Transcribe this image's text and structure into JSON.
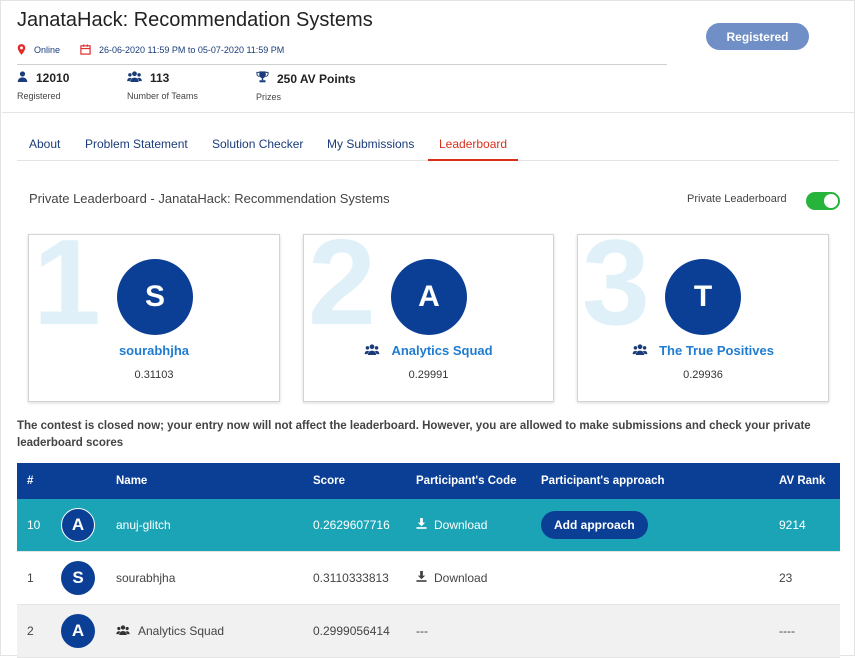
{
  "header": {
    "title": "JanataHack: Recommendation Systems",
    "mode": "Online",
    "dates": "26-06-2020 11:59 PM to 05-07-2020 11:59 PM",
    "register_button": "Registered",
    "stats": [
      {
        "value": "12010",
        "label": "Registered",
        "icon": "user-icon"
      },
      {
        "value": "113",
        "label": "Number of Teams",
        "icon": "team-icon"
      },
      {
        "value": "250 AV Points",
        "label": "Prizes",
        "icon": "trophy-icon"
      }
    ]
  },
  "tabs": [
    "About",
    "Problem Statement",
    "Solution Checker",
    "My Submissions",
    "Leaderboard"
  ],
  "active_tab": "Leaderboard",
  "leaderboard": {
    "title": "Private Leaderboard - JanataHack: Recommendation Systems",
    "toggle_label": "Private Leaderboard",
    "toggle_on": true
  },
  "podium": [
    {
      "rank": "1",
      "initial": "S",
      "name": "sourabhjha",
      "score": "0.31103",
      "team": false
    },
    {
      "rank": "2",
      "initial": "A",
      "name": "Analytics Squad",
      "score": "0.29991",
      "team": true
    },
    {
      "rank": "3",
      "initial": "T",
      "name": "The True Positives",
      "score": "0.29936",
      "team": true
    }
  ],
  "notice": "The contest is closed now; your entry now will not affect the leaderboard. However, you are allowed to make submissions and check your private leaderboard scores",
  "table": {
    "headers": [
      "#",
      "Name",
      "Score",
      "Participant's Code",
      "Participant's approach",
      "AV Rank"
    ],
    "rows": [
      {
        "rank": "10",
        "initial": "A",
        "name": "anuj-glitch",
        "score": "0.2629607716",
        "code": "Download",
        "approach": "Add approach",
        "av_rank": "9214"
      },
      {
        "rank": "1",
        "initial": "S",
        "name": "sourabhjha",
        "score": "0.3110333813",
        "code": "Download",
        "approach": "",
        "av_rank": "23"
      },
      {
        "rank": "2",
        "initial": "A",
        "name": "Analytics Squad",
        "score": "0.2999056414",
        "code": "---",
        "approach": "",
        "av_rank": "----"
      }
    ]
  },
  "colors": {
    "primary": "#0b3f96",
    "highlight": "#1ba4b5",
    "active_tab": "#d9301d",
    "toggle": "#27b43c",
    "link": "#1f7cd0"
  }
}
